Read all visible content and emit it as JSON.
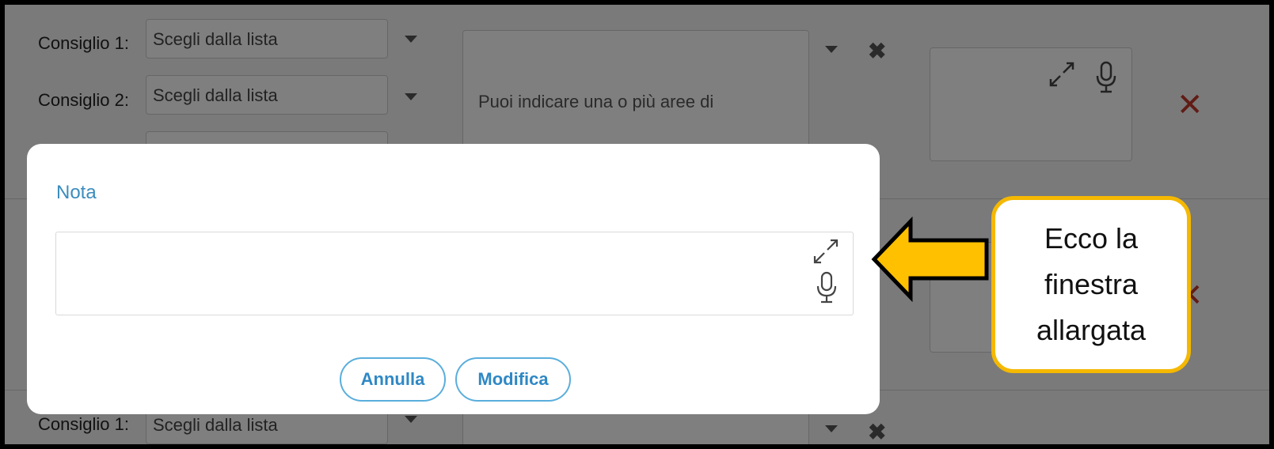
{
  "background": {
    "row1": {
      "consiglio1_label": "Consiglio 1:",
      "consiglio1_select": "Scegli dalla lista",
      "consiglio2_label": "Consiglio 2:",
      "consiglio2_select": "Scegli dalla lista",
      "areas_hint": "Puoi indicare una o più aree di"
    },
    "row3": {
      "consiglio1_label": "Consiglio 1:",
      "consiglio1_select": "Scegli dalla lista"
    }
  },
  "modal": {
    "title": "Nota",
    "field_value": "",
    "cancel_label": "Annulla",
    "confirm_label": "Modifica"
  },
  "callout": {
    "lines": [
      "Ecco la",
      "finestra",
      "allargata"
    ],
    "border_color": "#f5b800",
    "arrow_color": "#ffc000"
  },
  "colors": {
    "accent": "#3a8dbd",
    "delete": "#c0392b"
  }
}
